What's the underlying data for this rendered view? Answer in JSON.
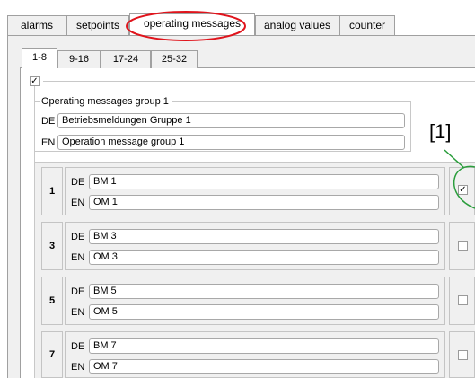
{
  "main_tabs": [
    {
      "label": "alarms"
    },
    {
      "label": "setpoints"
    },
    {
      "label": "operating messages"
    },
    {
      "label": "analog values"
    },
    {
      "label": "counter"
    }
  ],
  "sub_tabs": [
    {
      "label": "1-8"
    },
    {
      "label": "9-16"
    },
    {
      "label": "17-24"
    },
    {
      "label": "25-32"
    }
  ],
  "group": {
    "title": "Operating messages group 1",
    "de_label": "DE",
    "de_value": "Betriebsmeldungen Gruppe 1",
    "en_label": "EN",
    "en_value": "Operation message group 1"
  },
  "callout_label": "[1]",
  "rows": [
    {
      "number": "1",
      "de_label": "DE",
      "de_value": "BM 1",
      "en_label": "EN",
      "en_value": "OM 1"
    },
    {
      "number": "3",
      "de_label": "DE",
      "de_value": "BM 3",
      "en_label": "EN",
      "en_value": "OM 3"
    },
    {
      "number": "5",
      "de_label": "DE",
      "de_value": "BM 5",
      "en_label": "EN",
      "en_value": "OM 5"
    },
    {
      "number": "7",
      "de_label": "DE",
      "de_value": "BM 7",
      "en_label": "EN",
      "en_value": "OM 7"
    }
  ],
  "highlight_color": "#e0141c",
  "callout_color": "#2a9d3c"
}
